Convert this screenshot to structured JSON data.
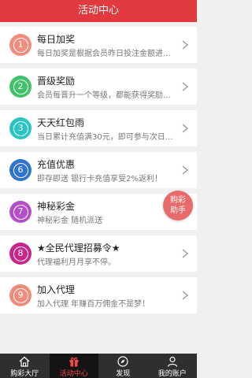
{
  "header": {
    "title": "活动中心"
  },
  "items": [
    {
      "num": "1",
      "color": "#f28c7d",
      "title": "每日加奖",
      "desc": "每日加奖是根据会员昨日投注金额进..."
    },
    {
      "num": "2",
      "color": "#3fc26a",
      "title": "晋级奖励",
      "desc": "会员每晋升一个等级，都能获得奖励..."
    },
    {
      "num": "3",
      "color": "#28c5c2",
      "title": "天天红包雨",
      "desc": "当日累计充值满30元，即可参与次日..."
    },
    {
      "num": "6",
      "color": "#2f74d0",
      "title": "充值优惠",
      "desc": "即存即送 银行卡充值享受2%返利！"
    },
    {
      "num": "7",
      "color": "#b54fc9",
      "title": "神秘彩金",
      "desc": "神秘彩金 随机派送"
    },
    {
      "num": "8",
      "color": "#c9248a",
      "title": "★全民代理招募令★",
      "desc": "代理福利月月享不停。"
    },
    {
      "num": "9",
      "color": "#f08a7a",
      "title": "加入代理",
      "desc": "加入代理 年赚百万佣金不是梦！"
    }
  ],
  "float_button": {
    "line1": "购彩",
    "line2": "助手"
  },
  "tabbar": {
    "tabs": [
      {
        "label": "购彩大厅",
        "icon": "home-icon"
      },
      {
        "label": "活动中心",
        "icon": "gift-icon",
        "active": true
      },
      {
        "label": "发现",
        "icon": "compass-icon"
      },
      {
        "label": "我的账户",
        "icon": "user-icon"
      }
    ]
  },
  "colors": {
    "header": "#e0393e",
    "tabbar": "#2f2f2f",
    "tab_active": "#ef4a4a",
    "float_button": "#e86a6a"
  }
}
